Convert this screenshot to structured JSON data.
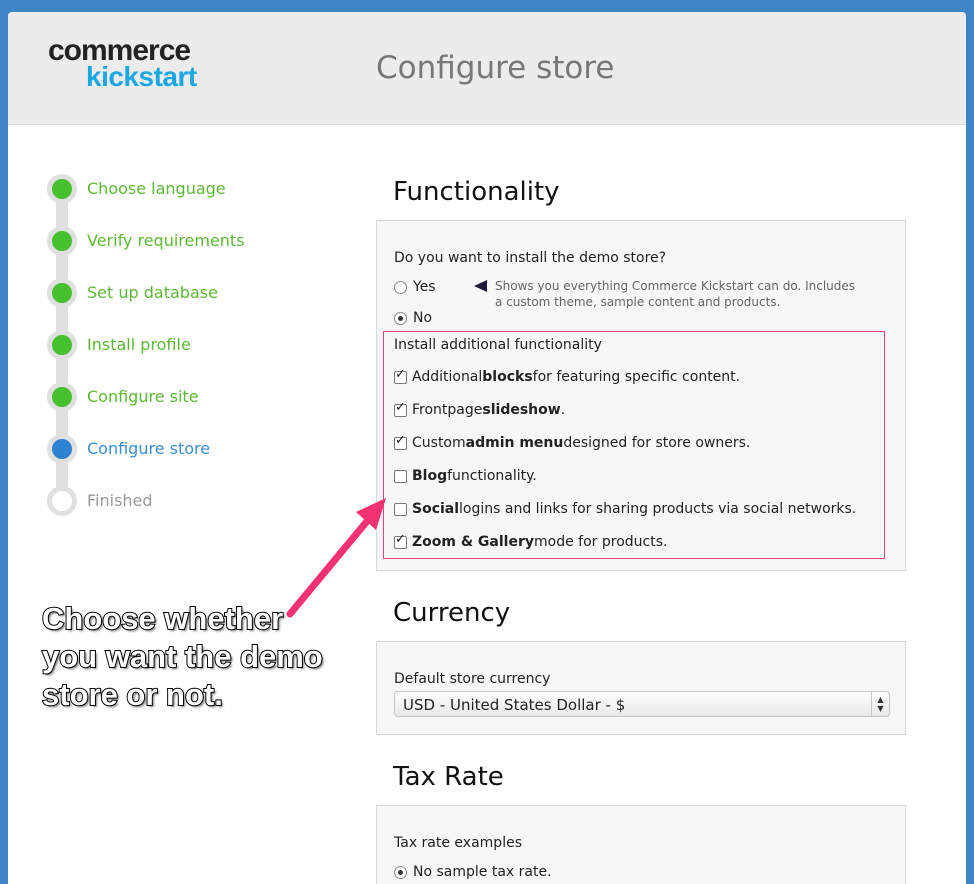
{
  "header": {
    "logo_top": "commerce",
    "logo_bottom": "kickstart",
    "page_title": "Configure store"
  },
  "steps": [
    {
      "label": "Choose language",
      "state": "done"
    },
    {
      "label": "Verify requirements",
      "state": "done"
    },
    {
      "label": "Set up database",
      "state": "done"
    },
    {
      "label": "Install profile",
      "state": "done"
    },
    {
      "label": "Configure site",
      "state": "done"
    },
    {
      "label": "Configure store",
      "state": "active"
    },
    {
      "label": "Finished",
      "state": "pending"
    }
  ],
  "functionality": {
    "title": "Functionality",
    "demo_question": "Do you want to install the demo store?",
    "yes_label": "Yes",
    "no_label": "No",
    "selected": "No",
    "hint": "Shows you everything Commerce Kickstart can do. Includes a custom theme, sample content and products.",
    "additional_title": "Install additional functionality",
    "options": [
      {
        "pre": "Additional ",
        "bold": "blocks",
        "post": " for featuring specific content.",
        "checked": true
      },
      {
        "pre": "Frontpage ",
        "bold": "slideshow",
        "post": ".",
        "checked": true
      },
      {
        "pre": "Custom ",
        "bold": "admin menu",
        "post": " designed for store owners.",
        "checked": true
      },
      {
        "pre": "",
        "bold": "Blog",
        "post": " functionality.",
        "checked": false
      },
      {
        "pre": "",
        "bold": "Social",
        "post": " logins and links for sharing products via social networks.",
        "checked": false
      },
      {
        "pre": "",
        "bold": "Zoom & Gallery",
        "post": " mode for products.",
        "checked": true
      }
    ]
  },
  "currency": {
    "title": "Currency",
    "field_label": "Default store currency",
    "selected": "USD - United States Dollar - $"
  },
  "tax": {
    "title": "Tax Rate",
    "field_label": "Tax rate examples",
    "selected": "No sample tax rate."
  },
  "annotation": {
    "line1": "Choose whether",
    "line2": "you want the demo",
    "line3": "store or not.",
    "color": "#f2336f"
  }
}
